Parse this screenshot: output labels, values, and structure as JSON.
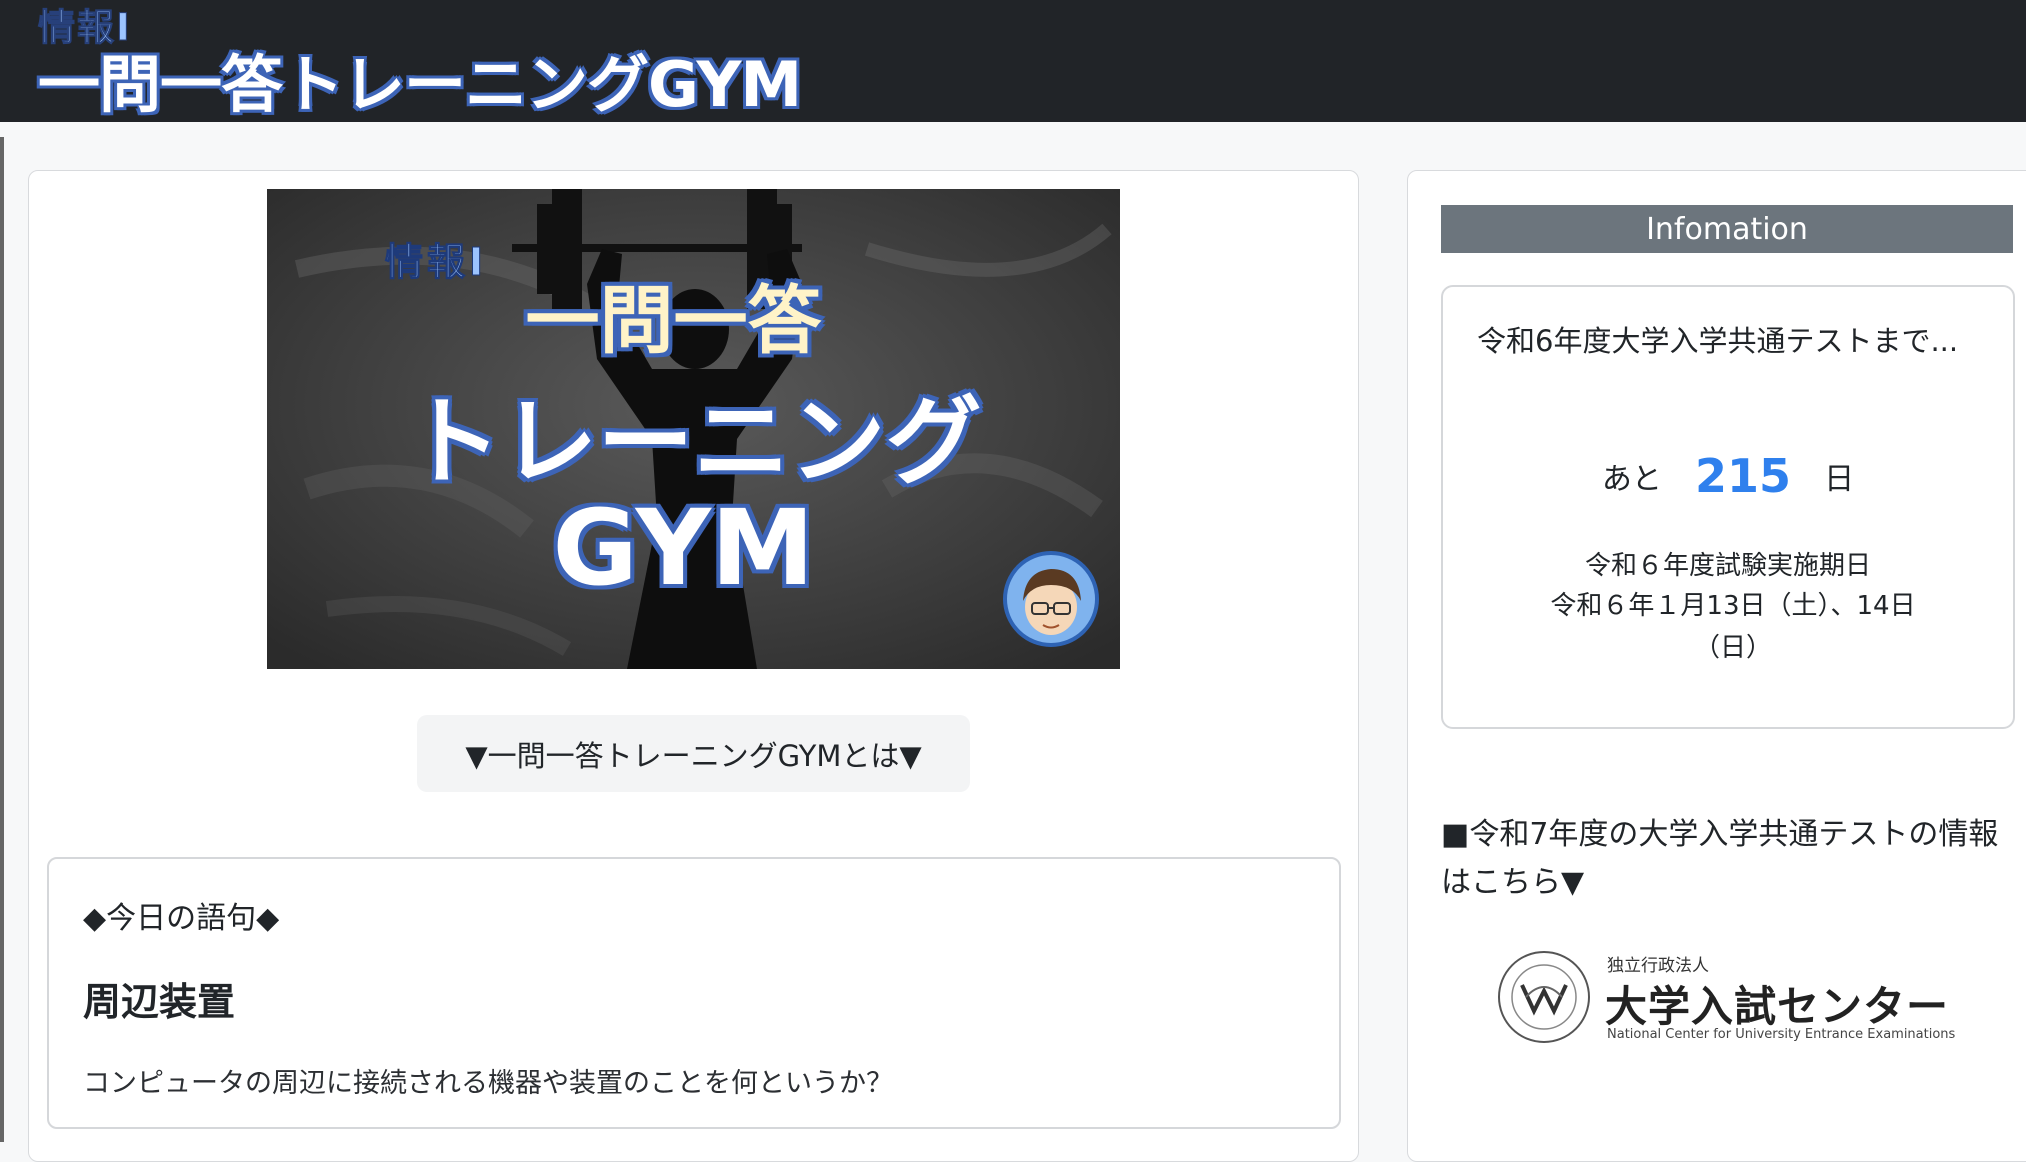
{
  "header": {
    "brand_sub": "情報Ⅰ",
    "brand_title": "一問一答トレーニングGYM"
  },
  "hero": {
    "sub": "情報Ⅰ",
    "line1": "一問一答",
    "line2": "トレーニング",
    "line3": "GYM"
  },
  "about_button": "▼一問一答トレーニングGYMとは▼",
  "word_of_day": {
    "heading": "◆今日の語句◆",
    "term": "周辺装置",
    "question": "コンピュータの周辺に接続される機器や装置のことを何というか？"
  },
  "sidebar": {
    "info_header": "Infomation",
    "countdown": {
      "title": "令和6年度大学入学共通テストまで...",
      "prefix": "あと",
      "days": "215",
      "suffix": "日",
      "date_title": "令和６年度試験実施期日",
      "date": "令和６年１月13日（土）、14日（日）"
    },
    "r7_info": "■令和7年度の大学入学共通テストの情報はこちら▼",
    "dnc": {
      "sub": "独立行政法人",
      "name": "大学入試センター",
      "english": "National Center for University Entrance Examinations"
    }
  },
  "colors": {
    "topbar": "#212428",
    "accent_blue": "#2f80ed",
    "info_header": "#6c757d",
    "title_outline": "#3d64b7"
  }
}
